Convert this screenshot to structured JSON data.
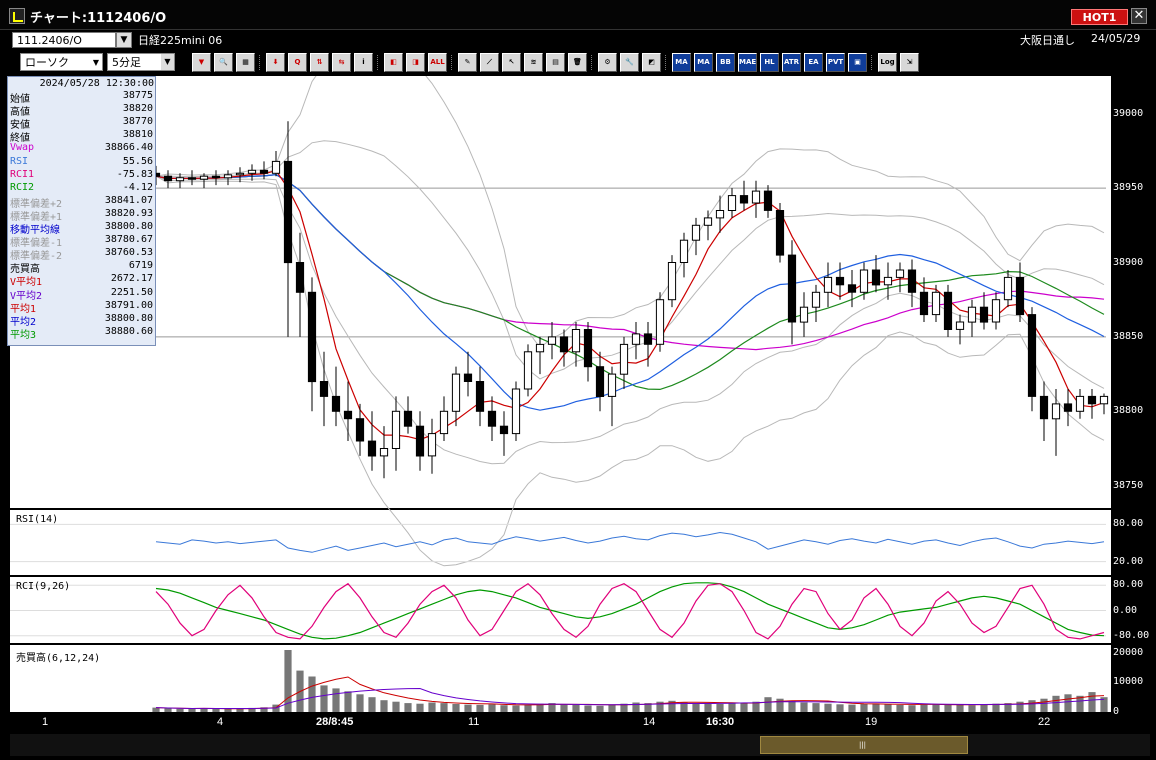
{
  "window": {
    "title": "チャート:1112406/O",
    "hot_label": "HOT1",
    "close_icon": "close-icon"
  },
  "symbol_bar": {
    "symbol": "111.2406/O",
    "instrument": "日経225mini 06",
    "session": "大阪日通し",
    "date": "24/05/29"
  },
  "controls": {
    "chart_type": "ローソク",
    "interval": "5分足"
  },
  "toolbar": [
    {
      "name": "trend-down-icon",
      "label": "▼",
      "style": "red"
    },
    {
      "name": "search-icon",
      "label": "🔍",
      "style": ""
    },
    {
      "name": "grid-icon",
      "label": "▦",
      "style": ""
    },
    {
      "name": "sep"
    },
    {
      "name": "arrow-down-icon",
      "label": "⬇",
      "style": "red"
    },
    {
      "name": "zoom-icon",
      "label": "Q",
      "style": "red"
    },
    {
      "name": "bar-compare-icon",
      "label": "⇅",
      "style": "red"
    },
    {
      "name": "bar-split-icon",
      "label": "⇆",
      "style": "red"
    },
    {
      "name": "info-icon",
      "label": "i",
      "style": ""
    },
    {
      "name": "sep"
    },
    {
      "name": "candle-minus-icon",
      "label": "◧",
      "style": "red"
    },
    {
      "name": "candle-plus-icon",
      "label": "◨",
      "style": "red"
    },
    {
      "name": "all-icon",
      "label": "ALL",
      "style": "red"
    },
    {
      "name": "sep"
    },
    {
      "name": "pencil-icon",
      "label": "✎",
      "style": ""
    },
    {
      "name": "line-draw-icon",
      "label": "⟋",
      "style": ""
    },
    {
      "name": "cursor-icon",
      "label": "↖",
      "style": ""
    },
    {
      "name": "fibo-icon",
      "label": "≋",
      "style": ""
    },
    {
      "name": "memo-icon",
      "label": "▤",
      "style": ""
    },
    {
      "name": "trash-icon",
      "label": "🗑",
      "style": ""
    },
    {
      "name": "sep"
    },
    {
      "name": "gear-icon",
      "label": "⚙",
      "style": ""
    },
    {
      "name": "wrench-icon",
      "label": "🔧",
      "style": ""
    },
    {
      "name": "color-icon",
      "label": "◩",
      "style": ""
    },
    {
      "name": "sep"
    },
    {
      "name": "indicator-bb-icon",
      "label": "MA",
      "style": "blue"
    },
    {
      "name": "indicator-ma-icon",
      "label": "MA",
      "style": "blue"
    },
    {
      "name": "indicator-be-icon",
      "label": "BB",
      "style": "blue"
    },
    {
      "name": "indicator-mae-icon",
      "label": "MAE",
      "style": "blue"
    },
    {
      "name": "indicator-hl-icon",
      "label": "HL",
      "style": "blue"
    },
    {
      "name": "indicator-atr-icon",
      "label": "ATR",
      "style": "blue"
    },
    {
      "name": "indicator-ea-icon",
      "label": "EA",
      "style": "blue"
    },
    {
      "name": "indicator-pvt-icon",
      "label": "PVT",
      "style": "blue"
    },
    {
      "name": "indicator-box-icon",
      "label": "▣",
      "style": "blue"
    },
    {
      "name": "sep"
    },
    {
      "name": "log-icon",
      "label": "Log",
      "style": ""
    },
    {
      "name": "export-icon",
      "label": "⇲",
      "style": ""
    }
  ],
  "info_panel": {
    "datetime": "2024/05/28  12:30:00",
    "rows": [
      {
        "label": "始値",
        "value": "38775",
        "color": "#000000"
      },
      {
        "label": "高値",
        "value": "38820",
        "color": "#000000"
      },
      {
        "label": "安値",
        "value": "38770",
        "color": "#000000"
      },
      {
        "label": "終値",
        "value": "38810",
        "color": "#000000"
      },
      {
        "label": "Vwap",
        "value": "38866.40",
        "color": "#cc00cc"
      },
      {
        "label": "RSI",
        "value": "55.56",
        "color": "#3a78d8"
      },
      {
        "label": "RCI1",
        "value": "-75.83",
        "color": "#e0007a"
      },
      {
        "label": "RCI2",
        "value": "-4.12",
        "color": "#009a00"
      },
      {
        "label": "標準偏差+2",
        "value": "38841.07",
        "color": "#999999"
      },
      {
        "label": "標準偏差+1",
        "value": "38820.93",
        "color": "#999999"
      },
      {
        "label": "移動平均線",
        "value": "38800.80",
        "color": "#0000cc"
      },
      {
        "label": "標準偏差-1",
        "value": "38780.67",
        "color": "#999999"
      },
      {
        "label": "標準偏差-2",
        "value": "38760.53",
        "color": "#999999"
      },
      {
        "label": "売買高",
        "value": "6719",
        "color": "#000000"
      },
      {
        "label": "V平均1",
        "value": "2672.17",
        "color": "#cc0000"
      },
      {
        "label": "V平均2",
        "value": "2251.50",
        "color": "#6600cc"
      },
      {
        "label": "平均1",
        "value": "38791.00",
        "color": "#cc0000"
      },
      {
        "label": "平均2",
        "value": "38800.80",
        "color": "#0000cc"
      },
      {
        "label": "平均3",
        "value": "38880.60",
        "color": "#009a00"
      }
    ]
  },
  "panes": {
    "rsi": "RSI(14)",
    "rci": "RCI(9,26)",
    "volume": "売買高(6,12,24)"
  },
  "colors": {
    "bull": "#ffffff",
    "bear": "#000000",
    "ma1": "#cc0000",
    "ma2": "#1f5fe0",
    "ma3": "#1e8a1e",
    "vwap": "#cc00cc",
    "bb": "#b8b8b8",
    "rsi": "#3a78d8",
    "rci1": "#e0007a",
    "rci2": "#009a00"
  },
  "chart_data": [
    {
      "type": "candlestick",
      "title": "日経225mini 06 5分足",
      "y_ticks": [
        "39000",
        "38950",
        "38900",
        "38850",
        "38800",
        "38750"
      ],
      "ylim": [
        38735,
        39020
      ],
      "x_ticks": [
        "1",
        "4",
        "28/8:45",
        "11",
        "14",
        "16:30",
        "19",
        "22"
      ],
      "hlines": [
        38950,
        38850
      ],
      "candles_note": "approximate OHLC reconstruction",
      "x": [
        0,
        1,
        2,
        3,
        4,
        5,
        6,
        7,
        8,
        9,
        10,
        11,
        12,
        13,
        14,
        15,
        16,
        17,
        18,
        19,
        20,
        21,
        22,
        23,
        24,
        25,
        26,
        27,
        28,
        29,
        30,
        31,
        32,
        33,
        34,
        35,
        36,
        37,
        38,
        39,
        40,
        41,
        42,
        43,
        44,
        45,
        46,
        47,
        48,
        49,
        50,
        51,
        52,
        53,
        54,
        55,
        56,
        57,
        58,
        59,
        60,
        61,
        62,
        63,
        64,
        65,
        66,
        67,
        68,
        69,
        70,
        71,
        72,
        73,
        74,
        75,
        76,
        77,
        78,
        79
      ],
      "ohlc": [
        [
          38960,
          38965,
          38952,
          38958
        ],
        [
          38958,
          38962,
          38950,
          38955
        ],
        [
          38955,
          38960,
          38950,
          38957
        ],
        [
          38957,
          38962,
          38952,
          38956
        ],
        [
          38956,
          38960,
          38950,
          38958
        ],
        [
          38958,
          38962,
          38952,
          38957
        ],
        [
          38957,
          38962,
          38952,
          38959
        ],
        [
          38959,
          38964,
          38954,
          38960
        ],
        [
          38960,
          38966,
          38955,
          38962
        ],
        [
          38962,
          38968,
          38956,
          38960
        ],
        [
          38960,
          38975,
          38958,
          38968
        ],
        [
          38968,
          38995,
          38850,
          38900
        ],
        [
          38900,
          38920,
          38850,
          38880
        ],
        [
          38880,
          38890,
          38800,
          38820
        ],
        [
          38820,
          38840,
          38790,
          38810
        ],
        [
          38810,
          38830,
          38790,
          38800
        ],
        [
          38800,
          38820,
          38780,
          38795
        ],
        [
          38795,
          38805,
          38770,
          38780
        ],
        [
          38780,
          38800,
          38760,
          38770
        ],
        [
          38770,
          38790,
          38755,
          38775
        ],
        [
          38775,
          38810,
          38760,
          38800
        ],
        [
          38800,
          38810,
          38785,
          38790
        ],
        [
          38790,
          38800,
          38760,
          38770
        ],
        [
          38770,
          38795,
          38758,
          38785
        ],
        [
          38785,
          38810,
          38780,
          38800
        ],
        [
          38800,
          38830,
          38790,
          38825
        ],
        [
          38825,
          38840,
          38810,
          38820
        ],
        [
          38820,
          38830,
          38790,
          38800
        ],
        [
          38800,
          38810,
          38780,
          38790
        ],
        [
          38790,
          38800,
          38770,
          38785
        ],
        [
          38785,
          38820,
          38780,
          38815
        ],
        [
          38815,
          38845,
          38810,
          38840
        ],
        [
          38840,
          38850,
          38825,
          38845
        ],
        [
          38845,
          38860,
          38835,
          38850
        ],
        [
          38850,
          38855,
          38830,
          38840
        ],
        [
          38840,
          38860,
          38830,
          38855
        ],
        [
          38855,
          38860,
          38820,
          38830
        ],
        [
          38830,
          38840,
          38800,
          38810
        ],
        [
          38810,
          38830,
          38790,
          38825
        ],
        [
          38825,
          38850,
          38815,
          38845
        ],
        [
          38845,
          38860,
          38835,
          38852
        ],
        [
          38852,
          38860,
          38830,
          38845
        ],
        [
          38845,
          38880,
          38840,
          38875
        ],
        [
          38875,
          38905,
          38870,
          38900
        ],
        [
          38900,
          38920,
          38890,
          38915
        ],
        [
          38915,
          38930,
          38905,
          38925
        ],
        [
          38925,
          38935,
          38915,
          38930
        ],
        [
          38930,
          38945,
          38920,
          38935
        ],
        [
          38935,
          38950,
          38930,
          38945
        ],
        [
          38945,
          38955,
          38935,
          38940
        ],
        [
          38940,
          38955,
          38930,
          38948
        ],
        [
          38948,
          38952,
          38930,
          38935
        ],
        [
          38935,
          38940,
          38900,
          38905
        ],
        [
          38905,
          38915,
          38845,
          38860
        ],
        [
          38860,
          38880,
          38850,
          38870
        ],
        [
          38870,
          38885,
          38860,
          38880
        ],
        [
          38880,
          38900,
          38870,
          38890
        ],
        [
          38890,
          38900,
          38875,
          38885
        ],
        [
          38885,
          38895,
          38870,
          38880
        ],
        [
          38880,
          38900,
          38875,
          38895
        ],
        [
          38895,
          38905,
          38880,
          38885
        ],
        [
          38885,
          38900,
          38875,
          38890
        ],
        [
          38890,
          38900,
          38880,
          38895
        ],
        [
          38895,
          38902,
          38870,
          38880
        ],
        [
          38880,
          38890,
          38860,
          38865
        ],
        [
          38865,
          38885,
          38860,
          38880
        ],
        [
          38880,
          38885,
          38850,
          38855
        ],
        [
          38855,
          38865,
          38845,
          38860
        ],
        [
          38860,
          38875,
          38850,
          38870
        ],
        [
          38870,
          38880,
          38855,
          38860
        ],
        [
          38860,
          38880,
          38855,
          38875
        ],
        [
          38875,
          38895,
          38870,
          38890
        ],
        [
          38890,
          38900,
          38860,
          38865
        ],
        [
          38865,
          38870,
          38800,
          38810
        ],
        [
          38810,
          38820,
          38780,
          38795
        ],
        [
          38795,
          38815,
          38770,
          38805
        ],
        [
          38805,
          38815,
          38790,
          38800
        ],
        [
          38800,
          38815,
          38795,
          38810
        ],
        [
          38810,
          38815,
          38795,
          38805
        ],
        [
          38805,
          38812,
          38798,
          38810
        ]
      ]
    },
    {
      "type": "line",
      "title": "RSI(14)",
      "y_ticks": [
        "80.00",
        "20.00"
      ],
      "ylim": [
        0,
        100
      ],
      "values": [
        52,
        50,
        48,
        55,
        53,
        50,
        52,
        49,
        51,
        53,
        55,
        42,
        38,
        35,
        40,
        45,
        38,
        42,
        46,
        50,
        44,
        48,
        52,
        47,
        55,
        58,
        52,
        50,
        48,
        55,
        60,
        57,
        53,
        56,
        59,
        54,
        50,
        53,
        58,
        61,
        57,
        55,
        62,
        66,
        64,
        60,
        63,
        67,
        64,
        58,
        52,
        40,
        45,
        50,
        55,
        52,
        48,
        54,
        57,
        53,
        50,
        56,
        52,
        48,
        53,
        55,
        50,
        46,
        52,
        56,
        58,
        52,
        45,
        42,
        48,
        50,
        53,
        51,
        49,
        52
      ]
    },
    {
      "type": "line",
      "title": "RCI(9,26)",
      "y_ticks": [
        "80.00",
        "0.00",
        "-80.00"
      ],
      "ylim": [
        -100,
        100
      ],
      "series": [
        {
          "name": "RCI1",
          "values": [
            60,
            20,
            -40,
            -80,
            -60,
            0,
            50,
            80,
            40,
            -20,
            -70,
            -85,
            -90,
            -50,
            10,
            60,
            85,
            40,
            -20,
            -70,
            -85,
            -40,
            20,
            60,
            80,
            40,
            -30,
            -80,
            -60,
            0,
            60,
            85,
            50,
            -10,
            -60,
            -85,
            -50,
            20,
            70,
            85,
            60,
            0,
            -60,
            -85,
            -40,
            30,
            80,
            85,
            60,
            0,
            -70,
            -90,
            -50,
            20,
            70,
            60,
            -10,
            -60,
            -30,
            40,
            70,
            20,
            -50,
            -80,
            -40,
            30,
            60,
            20,
            -40,
            -70,
            -50,
            10,
            70,
            80,
            20,
            -60,
            -85,
            -90,
            -80,
            -70
          ]
        },
        {
          "name": "RCI2",
          "values": [
            70,
            65,
            55,
            40,
            25,
            10,
            0,
            -10,
            -20,
            -30,
            -45,
            -60,
            -75,
            -85,
            -90,
            -88,
            -80,
            -70,
            -55,
            -40,
            -25,
            -10,
            5,
            20,
            35,
            50,
            60,
            65,
            60,
            50,
            40,
            25,
            10,
            0,
            -10,
            -20,
            -25,
            -20,
            -10,
            5,
            20,
            40,
            60,
            75,
            85,
            88,
            88,
            85,
            75,
            60,
            40,
            20,
            5,
            -10,
            -25,
            -40,
            -55,
            -60,
            -55,
            -45,
            -30,
            -15,
            -5,
            0,
            5,
            10,
            20,
            30,
            40,
            45,
            40,
            30,
            20,
            0,
            -20,
            -40,
            -60,
            -70,
            -78,
            -80
          ]
        }
      ]
    },
    {
      "type": "bar",
      "title": "売買高(6,12,24)",
      "y_ticks": [
        "20000",
        "10000",
        "0"
      ],
      "ylim": [
        0,
        22000
      ],
      "values": [
        1500,
        1200,
        1100,
        1000,
        1300,
        1100,
        1000,
        1200,
        1400,
        1600,
        2500,
        21000,
        14000,
        12000,
        9000,
        8000,
        7000,
        6000,
        5000,
        4000,
        3500,
        3000,
        2800,
        3200,
        3000,
        2700,
        2500,
        2400,
        2600,
        2300,
        2200,
        2500,
        2800,
        3000,
        2600,
        2400,
        2200,
        2100,
        2500,
        2800,
        3200,
        3000,
        3500,
        3800,
        3300,
        3000,
        2800,
        2700,
        3000,
        3200,
        3500,
        5000,
        4500,
        3800,
        3200,
        3000,
        2800,
        2600,
        2500,
        2700,
        2900,
        2600,
        2400,
        2300,
        2500,
        2700,
        2600,
        2400,
        2300,
        2500,
        2800,
        3000,
        3500,
        4000,
        4500,
        5500,
        6000,
        5500,
        6719,
        5000
      ]
    }
  ]
}
